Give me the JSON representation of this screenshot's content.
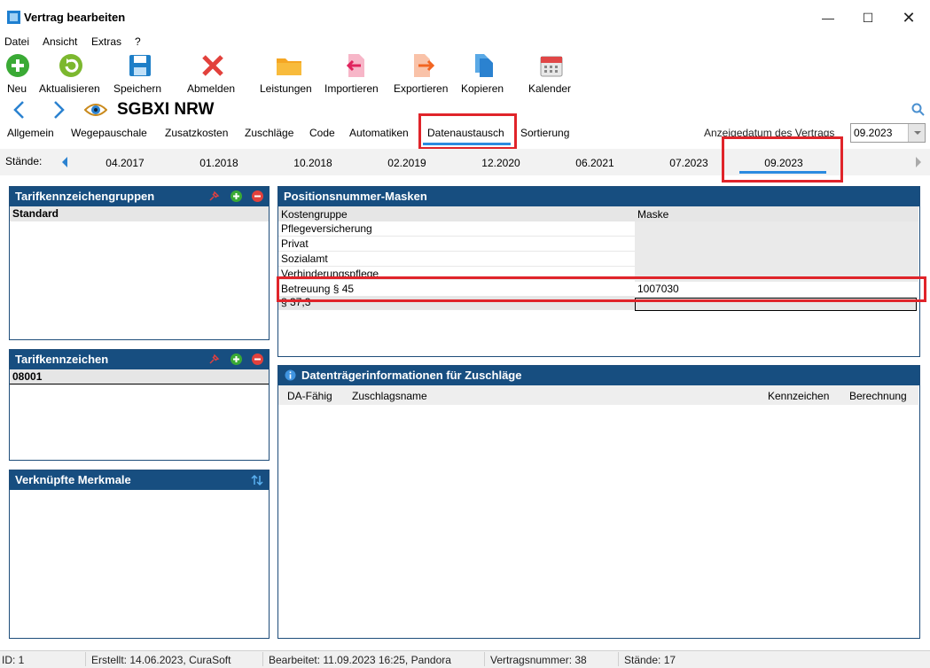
{
  "window": {
    "title": "Vertrag bearbeiten"
  },
  "menu": [
    "Datei",
    "Ansicht",
    "Extras",
    "?"
  ],
  "toolbar": {
    "neu": "Neu",
    "aktualisieren": "Aktualisieren",
    "speichern": "Speichern",
    "abmelden": "Abmelden",
    "leistungen": "Leistungen",
    "importieren": "Importieren",
    "exportieren": "Exportieren",
    "kopieren": "Kopieren",
    "kalender": "Kalender"
  },
  "contract": {
    "title": "SGBXI NRW"
  },
  "tabs": [
    "Allgemein",
    "Wegepauschale",
    "Zusatzkosten",
    "Zuschläge",
    "Code",
    "Automatiken",
    "Datenaustausch",
    "Sortierung"
  ],
  "active_tab": "Datenaustausch",
  "display_date": {
    "label": "Anzeigedatum des Vertrags",
    "value": "09.2023"
  },
  "staende": {
    "label": "Stände:",
    "items": [
      "04.2017",
      "01.2018",
      "10.2018",
      "02.2019",
      "12.2020",
      "06.2021",
      "07.2023",
      "09.2023"
    ],
    "active": "09.2023"
  },
  "tarif_groups": {
    "title": "Tarifkennzeichengruppen",
    "rows": [
      "Standard"
    ]
  },
  "tarif_codes": {
    "title": "Tarifkennzeichen",
    "rows": [
      "08001"
    ]
  },
  "merkmale": {
    "title": "Verknüpfte Merkmale"
  },
  "masks": {
    "title": "Positionsnummer-Masken",
    "col_group": "Kostengruppe",
    "col_mask": "Maske",
    "rows": [
      {
        "group": "Pflegeversicherung",
        "mask": ""
      },
      {
        "group": "Privat",
        "mask": ""
      },
      {
        "group": "Sozialamt",
        "mask": ""
      },
      {
        "group": "Verhinderungspflege",
        "mask": ""
      },
      {
        "group": "Betreuung § 45",
        "mask": "1007030"
      },
      {
        "group": "§ 37,3",
        "mask": ""
      }
    ]
  },
  "datentraeger": {
    "title": "Datenträgerinformationen für Zuschläge",
    "cols": [
      "DA-Fähig",
      "Zuschlagsname",
      "Kennzeichen",
      "Berechnung"
    ]
  },
  "status": {
    "id": "ID: 1",
    "created": "Erstellt: 14.06.2023, CuraSoft",
    "edited": "Bearbeitet: 11.09.2023 16:25, Pandora",
    "contract_no": "Vertragsnummer: 38",
    "staende": "Stände: 17"
  },
  "colors": {
    "panel_header": "#174e80",
    "accent": "#2b8be0",
    "highlight_box": "#e0242a"
  }
}
